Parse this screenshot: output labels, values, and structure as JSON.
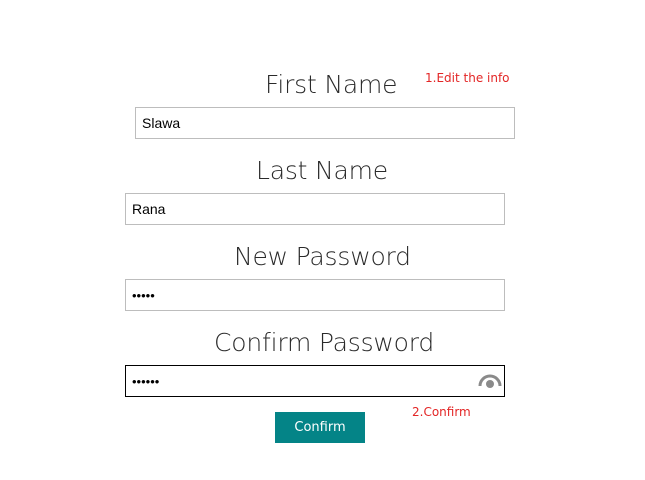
{
  "form": {
    "first_name": {
      "label": "First Name",
      "value": "Slawa"
    },
    "last_name": {
      "label": "Last Name",
      "value": "Rana"
    },
    "new_password": {
      "label": "New Password",
      "value": "•••••"
    },
    "confirm_password": {
      "label": "Confirm Password",
      "value": "••••••"
    },
    "confirm_button_label": "Confirm"
  },
  "annotations": {
    "step1": "1.Edit the info",
    "step2": "2.Confirm"
  },
  "colors": {
    "accent": "#048487",
    "annotation": "#e32626",
    "reveal_icon": "#8a8a8a"
  },
  "icons": {
    "password_reveal": "eye-icon"
  }
}
